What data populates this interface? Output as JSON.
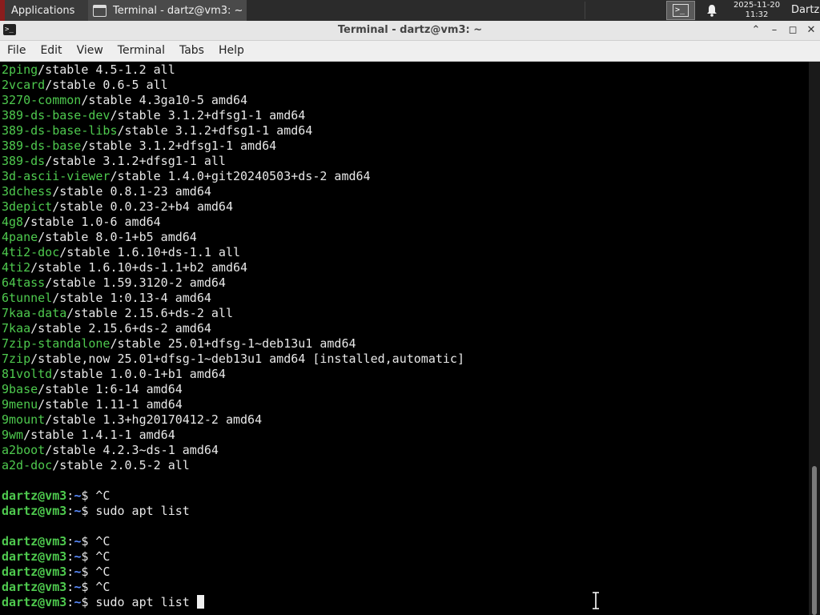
{
  "panel": {
    "applications_label": "Applications",
    "task_label": "Terminal - dartz@vm3: ~",
    "clock_date": "2025-11-20",
    "clock_time": "11:32",
    "user": "Dartz"
  },
  "window": {
    "title": "Terminal - dartz@vm3: ~",
    "minimize": "–",
    "maximize": "◻",
    "close": "✕",
    "collapse": "⌃"
  },
  "menu": [
    "File",
    "Edit",
    "View",
    "Terminal",
    "Tabs",
    "Help"
  ],
  "terminal": {
    "packages": [
      {
        "name": "2ping",
        "rest": "/stable 4.5-1.2 all"
      },
      {
        "name": "2vcard",
        "rest": "/stable 0.6-5 all"
      },
      {
        "name": "3270-common",
        "rest": "/stable 4.3ga10-5 amd64"
      },
      {
        "name": "389-ds-base-dev",
        "rest": "/stable 3.1.2+dfsg1-1 amd64"
      },
      {
        "name": "389-ds-base-libs",
        "rest": "/stable 3.1.2+dfsg1-1 amd64"
      },
      {
        "name": "389-ds-base",
        "rest": "/stable 3.1.2+dfsg1-1 amd64"
      },
      {
        "name": "389-ds",
        "rest": "/stable 3.1.2+dfsg1-1 all"
      },
      {
        "name": "3d-ascii-viewer",
        "rest": "/stable 1.4.0+git20240503+ds-2 amd64"
      },
      {
        "name": "3dchess",
        "rest": "/stable 0.8.1-23 amd64"
      },
      {
        "name": "3depict",
        "rest": "/stable 0.0.23-2+b4 amd64"
      },
      {
        "name": "4g8",
        "rest": "/stable 1.0-6 amd64"
      },
      {
        "name": "4pane",
        "rest": "/stable 8.0-1+b5 amd64"
      },
      {
        "name": "4ti2-doc",
        "rest": "/stable 1.6.10+ds-1.1 all"
      },
      {
        "name": "4ti2",
        "rest": "/stable 1.6.10+ds-1.1+b2 amd64"
      },
      {
        "name": "64tass",
        "rest": "/stable 1.59.3120-2 amd64"
      },
      {
        "name": "6tunnel",
        "rest": "/stable 1:0.13-4 amd64"
      },
      {
        "name": "7kaa-data",
        "rest": "/stable 2.15.6+ds-2 all"
      },
      {
        "name": "7kaa",
        "rest": "/stable 2.15.6+ds-2 amd64"
      },
      {
        "name": "7zip-standalone",
        "rest": "/stable 25.01+dfsg-1~deb13u1 amd64"
      },
      {
        "name": "7zip",
        "rest": "/stable,now 25.01+dfsg-1~deb13u1 amd64 [installed,automatic]"
      },
      {
        "name": "81voltd",
        "rest": "/stable 1.0.0-1+b1 amd64"
      },
      {
        "name": "9base",
        "rest": "/stable 1:6-14 amd64"
      },
      {
        "name": "9menu",
        "rest": "/stable 1.11-1 amd64"
      },
      {
        "name": "9mount",
        "rest": "/stable 1.3+hg20170412-2 amd64"
      },
      {
        "name": "9wm",
        "rest": "/stable 1.4.1-1 amd64"
      },
      {
        "name": "a2boot",
        "rest": "/stable 4.2.3~ds-1 amd64"
      },
      {
        "name": "a2d-doc",
        "rest": "/stable 2.0.5-2 all"
      }
    ],
    "prompt_user": "dartz@vm3",
    "prompt_sep": ":",
    "prompt_path": "~",
    "prompt_sigil": "$ ",
    "commands": [
      {
        "text": "^C",
        "blank_after": false
      },
      {
        "text": "sudo apt list",
        "blank_after": true
      },
      {
        "text": "^C",
        "blank_after": false
      },
      {
        "text": "^C",
        "blank_after": false
      },
      {
        "text": "^C",
        "blank_after": false
      },
      {
        "text": "^C",
        "blank_after": false
      }
    ],
    "current_command": "sudo apt list "
  },
  "colors": {
    "package_green": "#4ec94e",
    "prompt_blue": "#5b8cff",
    "terminal_bg": "#000000"
  }
}
